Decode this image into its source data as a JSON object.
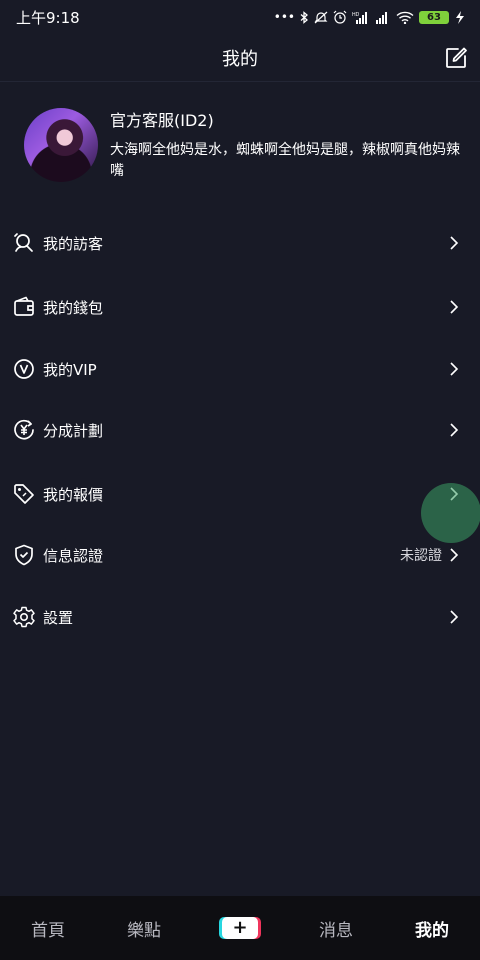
{
  "status_bar": {
    "time": "上午9:18",
    "icons": [
      "dots-icon",
      "bluetooth-icon",
      "mute-icon",
      "alarm-icon",
      "hd-signal-icon",
      "signal-icon",
      "wifi-icon",
      "battery-icon",
      "charging-icon"
    ],
    "battery_level": "63"
  },
  "header": {
    "title": "我的"
  },
  "profile": {
    "name": "官方客服(ID2)",
    "bio": "大海啊全他妈是水，蜘蛛啊全他妈是腿，辣椒啊真他妈辣嘴"
  },
  "menu": {
    "items": [
      {
        "label": "我的訪客",
        "icon": "visitor-icon",
        "value": ""
      },
      {
        "label": "我的錢包",
        "icon": "wallet-icon",
        "value": ""
      },
      {
        "label": "我的VIP",
        "icon": "vip-icon",
        "value": ""
      },
      {
        "label": "分成計劃",
        "icon": "yen-coin-icon",
        "value": ""
      },
      {
        "label": "我的報價",
        "icon": "price-tag-icon",
        "value": ""
      },
      {
        "label": "信息認證",
        "icon": "shield-check-icon",
        "value": "未認證"
      },
      {
        "label": "設置",
        "icon": "gear-icon",
        "value": ""
      }
    ]
  },
  "bottom_nav": {
    "items": [
      {
        "label": "首頁",
        "active": false
      },
      {
        "label": "樂點",
        "active": false
      },
      {
        "label": "+",
        "active": false
      },
      {
        "label": "消息",
        "active": false
      },
      {
        "label": "我的",
        "active": true
      }
    ]
  },
  "colors": {
    "background": "#181a26",
    "nav_background": "#0e0e12",
    "battery": "#7fd13b",
    "touch_ripple": "#3ca064"
  }
}
